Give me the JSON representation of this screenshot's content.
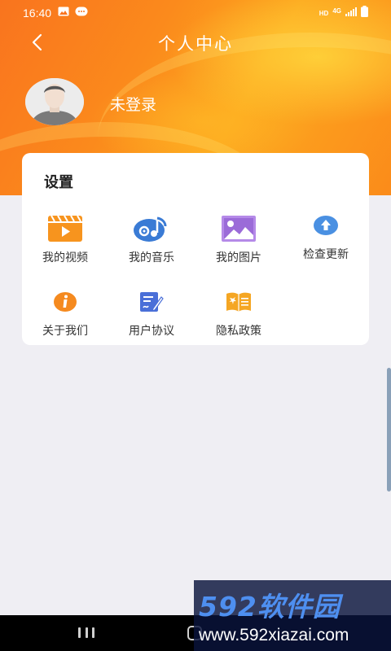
{
  "status_bar": {
    "time": "16:40",
    "left_icons": [
      "image-icon",
      "message-icon"
    ],
    "hd_label": "HD",
    "network_label": "4G",
    "right_icons": [
      "signal-icon",
      "battery-icon"
    ]
  },
  "header": {
    "title": "个人中心",
    "back_icon": "back-arrow-icon",
    "login_status": "未登录"
  },
  "settings": {
    "title": "设置",
    "items": [
      {
        "label": "我的视频",
        "icon": "video-icon",
        "color": "#f7941e"
      },
      {
        "label": "我的音乐",
        "icon": "music-disc-icon",
        "color": "#3a7bd5"
      },
      {
        "label": "我的图片",
        "icon": "picture-icon",
        "color": "#9b6bd8"
      },
      {
        "label": "检查更新",
        "icon": "upload-arrow-icon",
        "color": "#4a90e2"
      },
      {
        "label": "关于我们",
        "icon": "info-icon",
        "color": "#f58a1f"
      },
      {
        "label": "用户协议",
        "icon": "document-edit-icon",
        "color": "#4a6fd8"
      },
      {
        "label": "隐私政策",
        "icon": "open-book-icon",
        "color": "#f5a623"
      }
    ]
  },
  "colors": {
    "header_orange": "#fb8a1c",
    "header_yellow": "#ffd23c",
    "background": "#efeef3"
  },
  "watermark": {
    "logo_text": "592软件园",
    "url": "www.592xiazai.com"
  }
}
